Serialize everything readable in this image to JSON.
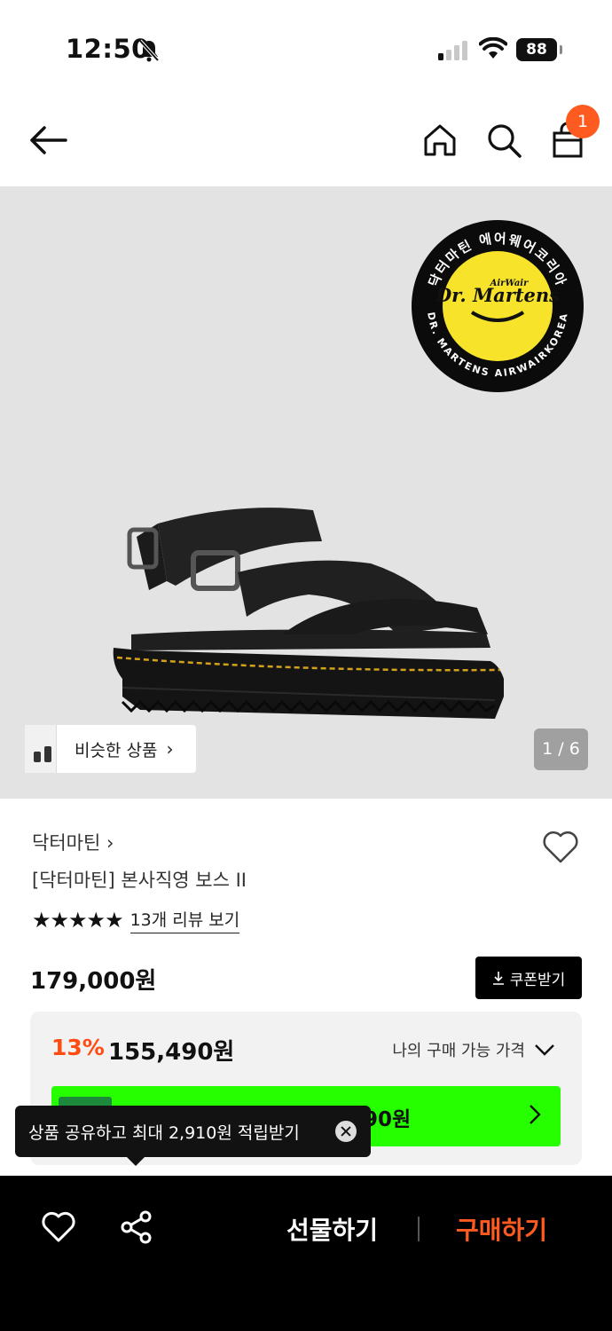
{
  "status_bar": {
    "time": "12:50",
    "battery": "88",
    "icons": [
      "bell-muted-icon",
      "signal-icon",
      "wifi-icon",
      "battery-icon"
    ]
  },
  "nav": {
    "icons": [
      "back-arrow-icon",
      "home-icon",
      "search-icon",
      "shopping-bag-icon"
    ],
    "cart_count": "1"
  },
  "hero": {
    "badge_text": "닥터마틴 에어웨어코리아",
    "badge_brand": "Dr. Martens",
    "badge_airwair": "AirWair",
    "badge_footer": "DR. MARTENS AIRWAIRKOREA",
    "similar_label": "비슷한 상품",
    "page_indicator": "1 / 6"
  },
  "product": {
    "brand": "닥터마틴",
    "title": "[닥터마틴] 본사직영 보스 II",
    "rating_stars": "★★★★★",
    "rating": 5,
    "review_link": "13개 리뷰 보기",
    "price": "179,000원",
    "coupon_label": "쿠폰받기"
  },
  "discount": {
    "rate": "13%",
    "price": "155,490원",
    "my_price_label": "나의 구매 가능 가격",
    "green_bar_text": "90원",
    "accent": "#ff4c13",
    "green": "#26ff00"
  },
  "tooltip": {
    "text": "상품 공유하고 최대 2,910원 적립받기"
  },
  "bottom_bar": {
    "gift_label": "선물하기",
    "buy_label": "구매하기",
    "buy_color": "#ff5a1f"
  }
}
